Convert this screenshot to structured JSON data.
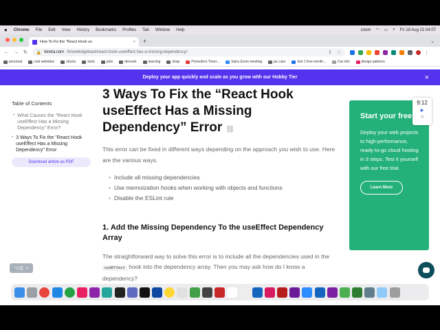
{
  "menubar": {
    "app": "Chrome",
    "items": [
      "File",
      "Edit",
      "View",
      "History",
      "Bookmarks",
      "Profiles",
      "Tab",
      "Window",
      "Help"
    ],
    "zoom": "zoom",
    "datetime": "Fri 18 Aug  21:04:07"
  },
  "tab": {
    "title": "How To Fix the \"React Hook us",
    "close": "×",
    "new_tab": "+"
  },
  "address": {
    "domain": "kinsta.com",
    "path": "/knowledgebase/react-hook-useeffect-has-a-missing-dependency/"
  },
  "bookmarks": [
    "personal",
    "cool websites",
    "stocks",
    "tools",
    "jobs",
    "devrack",
    "learning",
    "shop",
    "Pomodoro Timer...",
    "Saira Zoom meeting",
    "jac cars",
    "Get 1 free month...",
    "Car info",
    "design patterns"
  ],
  "banner": {
    "text": "Deploy your app quickly and scale as you grow with our Hobby Tier",
    "close": "×"
  },
  "toc": {
    "heading": "Table of Contents",
    "items": [
      {
        "label": "What Causes the \"React Hook useEffect Has a Missing Dependency\" Error?"
      },
      {
        "label": "3 Ways To Fix the \"React Hook useEffect Has a Missing Dependency\" Error"
      }
    ],
    "download": "Download article as PDF"
  },
  "article": {
    "title": "3 Ways To Fix the “React Hook useEffect Has a Missing Dependency” Error",
    "intro": "This error can be fixed in different ways depending on the approach you wish to use. Here are the various ways.",
    "bullets": [
      "Include all missing dependencies",
      "Use memoization hooks when working with objects and functions",
      "Disable the ESLint rule"
    ],
    "h2": "1. Add the Missing Dependency To the useEffect Dependency Array",
    "para_start": "The straightforward way to solve this error is to include all the dependencies used in the",
    "para_code": "useEffect",
    "para_end": "hook into the dependency array. Then you may ask how do I know a dependency?"
  },
  "promo": {
    "title": "Start your free trial",
    "body": "Deploy your web projects to high-performance, ready-to-go cloud hosting in 3 steps. Test it yourself with our free trial.",
    "button": "Learn More"
  },
  "timer": {
    "time": "9:12"
  },
  "kbd": {
    "label": "⌥Q"
  },
  "colors": {
    "brand": "#5333ed",
    "promo": "#23b179",
    "chat": "#0e4d5c"
  }
}
